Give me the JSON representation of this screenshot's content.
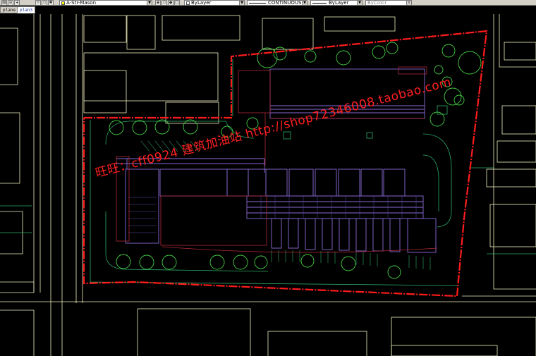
{
  "toolbar": {
    "layer_value": "A-Str-Mason",
    "layer_color": "#ffff00",
    "color_value": "ByLayer",
    "linetype_value": "CONTINUOUS",
    "lineweight_value": "ByLayer",
    "plotstyle_value": "ByColor"
  },
  "tabs": [
    {
      "label": "plane"
    },
    {
      "label": "plan3"
    }
  ],
  "watermark": {
    "text": "旺旺：cff0924  建筑加油站  http://shop72346008.taobao.com",
    "color": "#ff2020"
  },
  "drawing_colors": {
    "boundary": "#ff1c1c",
    "buildings": "#8a6ad6",
    "context_lines": "#f0f0c0",
    "landscape": "#44d044",
    "site_lines": "#2fae6a"
  }
}
